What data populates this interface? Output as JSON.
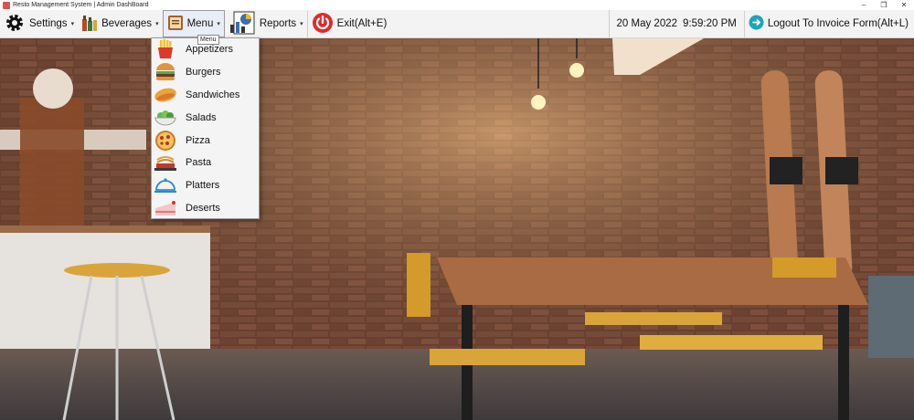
{
  "window": {
    "title": "Resto Management System  | Admin DashBoard",
    "controls": [
      "–",
      "❐",
      "✕"
    ]
  },
  "menubar": {
    "settings_label": "Settings",
    "beverages_label": "Beverages",
    "menu_label": "Menu",
    "reports_label": "Reports",
    "exit_label": "Exit(Alt+E)",
    "date": "20 May 2022",
    "time": "9:59:20 PM",
    "logout_label": "Logout To Invoice Form(Alt+L)"
  },
  "tooltip": "Menu",
  "dropdown": {
    "items": [
      {
        "label": "Appetizers",
        "icon": "fries-icon"
      },
      {
        "label": "Burgers",
        "icon": "burger-icon"
      },
      {
        "label": "Sandwiches",
        "icon": "sandwich-icon"
      },
      {
        "label": "Salads",
        "icon": "salad-icon"
      },
      {
        "label": "Pizza",
        "icon": "pizza-icon"
      },
      {
        "label": "Pasta",
        "icon": "pasta-icon"
      },
      {
        "label": "Platters",
        "icon": "platter-icon"
      },
      {
        "label": "Deserts",
        "icon": "cake-icon"
      }
    ]
  }
}
